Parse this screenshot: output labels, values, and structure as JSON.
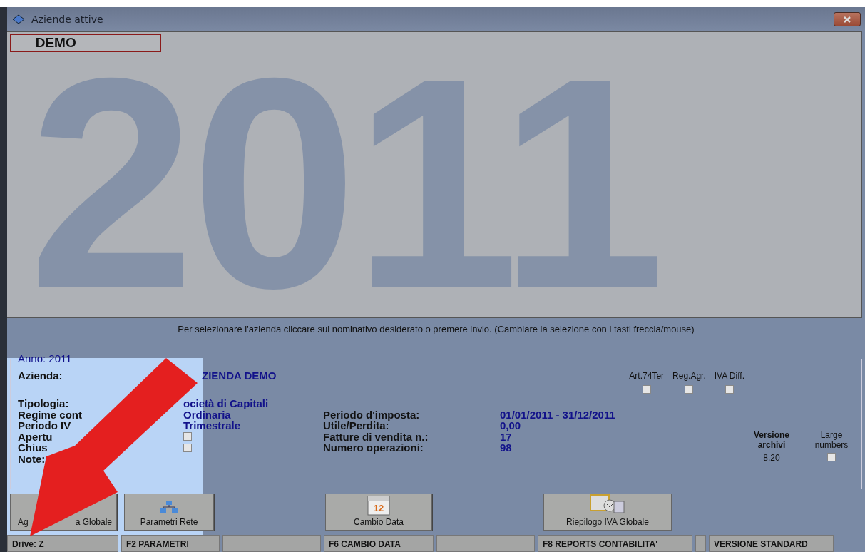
{
  "window": {
    "title": "Aziende attive"
  },
  "company_list": {
    "items": [
      {
        "label": "___DEMO___",
        "selected": true
      }
    ],
    "background_year": "2011"
  },
  "instruction": "Per selezionare l'azienda cliccare sul nominativo desiderato o premere invio. (Cambiare la selezione con i tasti freccia/mouse)",
  "info": {
    "legend": "Anno: 2011",
    "azienda_label": "Azienda:",
    "azienda_value": "ZIENDA DEMO",
    "flags": [
      {
        "label": "Art.74Ter",
        "checked": false
      },
      {
        "label": "Reg.Agr.",
        "checked": false
      },
      {
        "label": "IVA Diff.",
        "checked": false
      }
    ],
    "rows": [
      {
        "label": "Tipologia:",
        "value": "ocietà di Capitali",
        "kind": "text"
      },
      {
        "label": "Regime cont",
        "value": "Ordinaria",
        "kind": "text"
      },
      {
        "label": "Periodo IV",
        "value": "Trimestrale",
        "kind": "text"
      },
      {
        "label": "Apertu",
        "checked": false,
        "kind": "check"
      },
      {
        "label": "Chius",
        "checked": false,
        "kind": "check"
      },
      {
        "label": "Note:",
        "kind": "none"
      }
    ],
    "stats": [
      {
        "label": "Periodo d'imposta:",
        "value": "01/01/2011 - 31/12/2011"
      },
      {
        "label": "Utile/Perdita:",
        "value": "0,00"
      },
      {
        "label": "Fatture di vendita n.:",
        "value": "17"
      },
      {
        "label": "Numero operazioni:",
        "value": "98"
      }
    ],
    "version_label": "Versione archivi",
    "version_value": "8.20",
    "large_numbers": {
      "label": "Large numbers",
      "checked": false
    }
  },
  "buttons": [
    {
      "label": "Ag",
      "label_rest": "a Globale",
      "kind": "plain"
    },
    {
      "label": "Parametri Rete",
      "kind": "network"
    },
    {
      "label": "Cambio Data",
      "kind": "calendar",
      "icon_text": "12"
    },
    {
      "label": "Riepilogo IVA Globale",
      "kind": "summary"
    }
  ],
  "status_bar": [
    "Drive: Z",
    "F2 PARAMETRI",
    "F6 CAMBIO DATA",
    "F8 REPORTS CONTABILITA'",
    "VERSIONE STANDARD"
  ]
}
